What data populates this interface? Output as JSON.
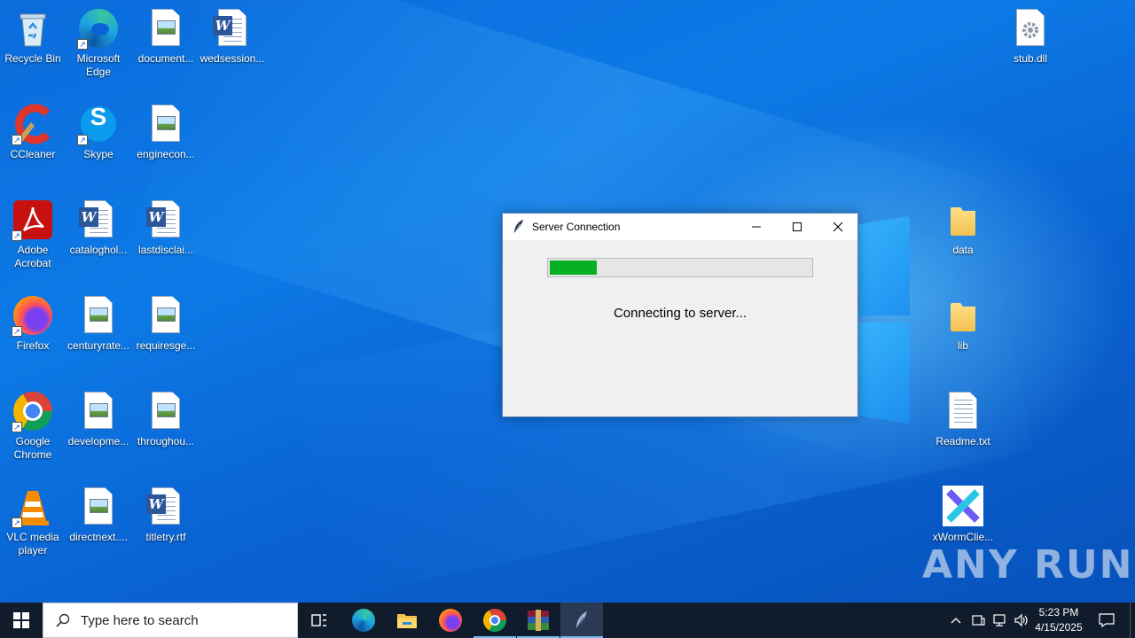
{
  "desktop": {
    "icons": [
      {
        "label": "Recycle Bin",
        "icon": "recycle-bin-icon"
      },
      {
        "label": "Microsoft Edge",
        "icon": "edge-icon"
      },
      {
        "label": "document...",
        "icon": "image-file-icon"
      },
      {
        "label": "wedsession...",
        "icon": "word-document-icon"
      },
      {
        "label": "CCleaner",
        "icon": "ccleaner-icon"
      },
      {
        "label": "Skype",
        "icon": "skype-icon"
      },
      {
        "label": "enginecon...",
        "icon": "image-file-icon"
      },
      {
        "label": "Adobe Acrobat",
        "icon": "acrobat-icon"
      },
      {
        "label": "cataloghol...",
        "icon": "word-document-icon"
      },
      {
        "label": "lastdisclai...",
        "icon": "word-document-icon"
      },
      {
        "label": "Firefox",
        "icon": "firefox-icon"
      },
      {
        "label": "centuryrate...",
        "icon": "image-file-icon"
      },
      {
        "label": "requiresge...",
        "icon": "image-file-icon"
      },
      {
        "label": "Google Chrome",
        "icon": "chrome-icon"
      },
      {
        "label": "developme...",
        "icon": "image-file-icon"
      },
      {
        "label": "throughou...",
        "icon": "image-file-icon"
      },
      {
        "label": "VLC media player",
        "icon": "vlc-icon"
      },
      {
        "label": "directnext....",
        "icon": "image-file-icon"
      },
      {
        "label": "titletry.rtf",
        "icon": "word-document-icon"
      },
      {
        "label": "stub.dll",
        "icon": "dll-file-icon"
      },
      {
        "label": "data",
        "icon": "folder-icon"
      },
      {
        "label": "lib",
        "icon": "folder-icon"
      },
      {
        "label": "Readme.txt",
        "icon": "text-file-icon"
      },
      {
        "label": "xWormClie...",
        "icon": "xworm-icon"
      }
    ]
  },
  "dialog": {
    "title": "Server Connection",
    "progress_fraction": 0.18,
    "status_text": "Connecting to server..."
  },
  "taskbar": {
    "search_placeholder": "Type here to search",
    "apps": [
      "task-view-icon",
      "edge-icon",
      "file-explorer-icon",
      "firefox-icon",
      "chrome-icon",
      "winrar-icon",
      "python-feather-icon"
    ],
    "time": "5:23 PM",
    "date": "4/15/2025"
  },
  "watermark": "ANY RUN",
  "colors": {
    "desktop_bg": "#0a63d6",
    "taskbar_bg": "#101b2b",
    "progress_fill": "#06b025"
  }
}
